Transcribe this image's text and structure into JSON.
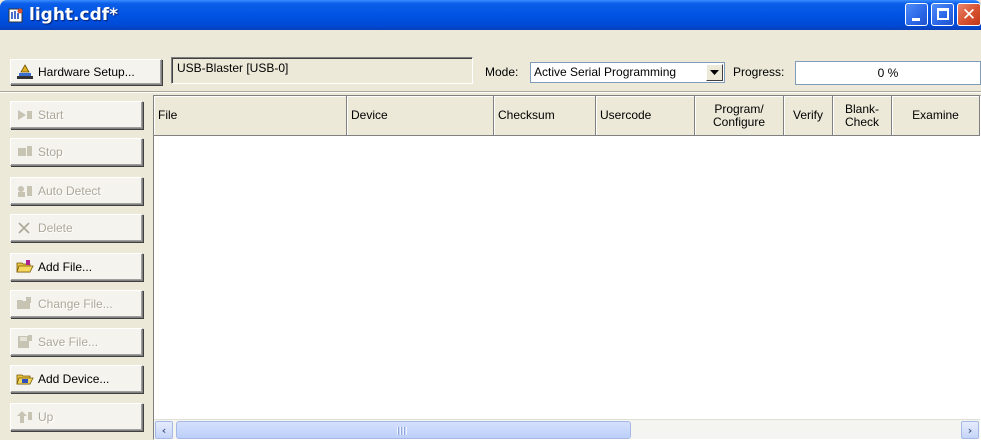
{
  "window": {
    "title": "light.cdf*",
    "title_bar_color": "#0054e3",
    "close_button_color": "#d6512f",
    "window_buttons": [
      "minimize",
      "maximize",
      "close"
    ]
  },
  "toolbar": {
    "hardware_setup_label": "Hardware Setup...",
    "hardware_value": "USB-Blaster [USB-0]",
    "mode_label": "Mode:",
    "mode_value": "Active Serial Programming",
    "progress_label": "Progress:",
    "progress_value": "0 %",
    "progress_fraction": 0
  },
  "sidebar": {
    "buttons": [
      {
        "label": "Start",
        "icon": "start-icon",
        "enabled": false
      },
      {
        "label": "Stop",
        "icon": "stop-icon",
        "enabled": false
      },
      {
        "label": "Auto Detect",
        "icon": "auto-detect-icon",
        "enabled": false
      },
      {
        "label": "Delete",
        "icon": "delete-x-icon",
        "enabled": false
      },
      {
        "label": "Add File...",
        "icon": "open-folder-icon",
        "enabled": true
      },
      {
        "label": "Change File...",
        "icon": "change-file-icon",
        "enabled": false
      },
      {
        "label": "Save File...",
        "icon": "save-disk-icon",
        "enabled": false
      },
      {
        "label": "Add Device...",
        "icon": "add-device-icon",
        "enabled": true
      },
      {
        "label": "Up",
        "icon": "up-arrow-icon",
        "enabled": false
      }
    ]
  },
  "table": {
    "columns": [
      {
        "label": "File"
      },
      {
        "label": "Device"
      },
      {
        "label": "Checksum"
      },
      {
        "label": "Usercode"
      },
      {
        "label": "Program/\nConfigure"
      },
      {
        "label": "Verify"
      },
      {
        "label": "Blank-\nCheck"
      },
      {
        "label": "Examine"
      }
    ],
    "rows": []
  },
  "scrollbar": {
    "left_arrow": "‹",
    "right_arrow": "›"
  }
}
